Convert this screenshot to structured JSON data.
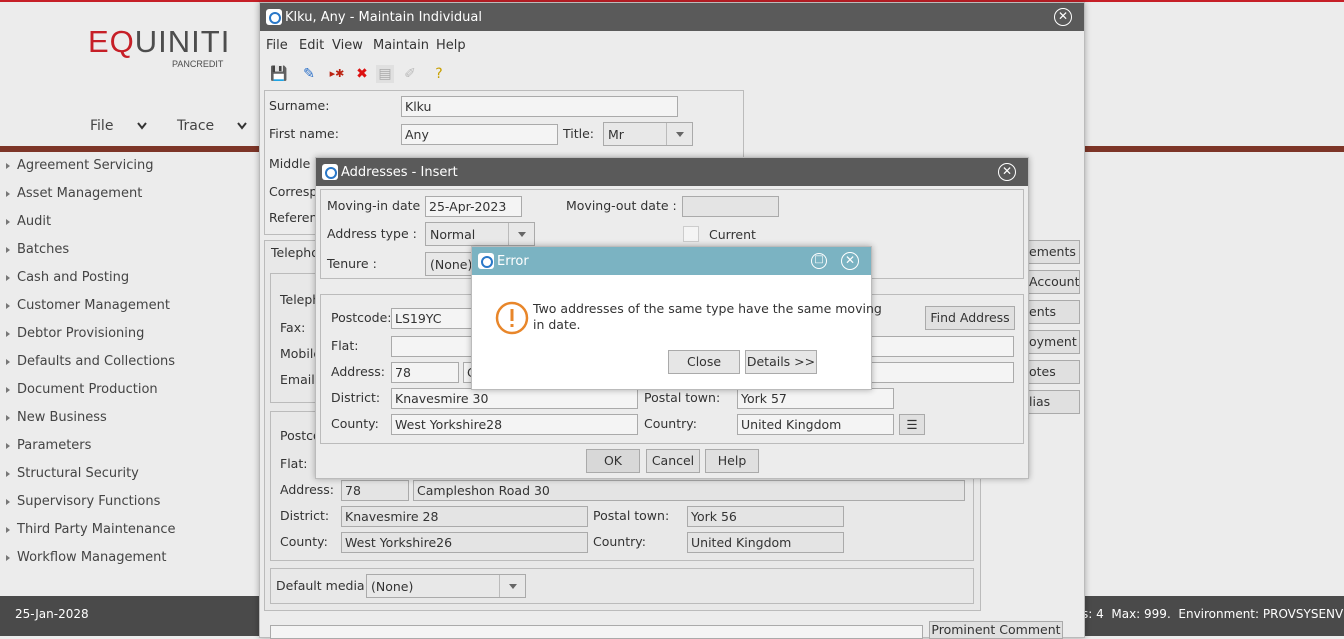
{
  "app": {
    "logo_text": "EQUINITI",
    "logo_sub": "PANCREDIT",
    "top_menu": [
      "File",
      "Trace"
    ],
    "sidebar_items": [
      "Agreement Servicing",
      "Asset Management",
      "Audit",
      "Batches",
      "Cash and Posting",
      "Customer Management",
      "Debtor Provisioning",
      "Defaults and Collections",
      "Document Production",
      "New Business",
      "Parameters",
      "Structural Security",
      "Supervisory Functions",
      "Third Party Maintenance",
      "Workflow Management"
    ],
    "footer_date": "25-Jan-2028",
    "footer_status": "s: 4  Max: 999.  Environment: PROVSYSENV"
  },
  "main_window": {
    "title": "Klku, Any - Maintain Individual",
    "menu": [
      "File",
      "Edit",
      "View",
      "Maintain",
      "Help"
    ],
    "surname_label": "Surname:",
    "surname": "Klku",
    "firstname_label": "First name:",
    "firstname": "Any",
    "title_label": "Title:",
    "title_value": "Mr",
    "middle_label": "Middle n",
    "corresp_label": "Corresp",
    "reference_label": "Referen",
    "telephone_tab": "Telepho",
    "telephone_label": "Teleph",
    "fax_label": "Fax:",
    "mobile_label": "Mobile",
    "email_label": "Email",
    "postcode_label": "Postco",
    "flat_label": "Flat:",
    "address_label": "Address:",
    "address_no": "78",
    "address_street": "Campleshon Road 30",
    "district_label": "District:",
    "district": "Knavesmire 28",
    "postal_town_label": "Postal town:",
    "postal_town": "York 56",
    "county_label": "County:",
    "county": "West Yorkshire26",
    "country_label": "Country:",
    "country": "United Kingdom",
    "default_media_label": "Default media:",
    "default_media": "(None)",
    "side_buttons": [
      "ements",
      "Account",
      "ents",
      "oyment",
      "otes",
      "lias"
    ],
    "prominent_comment": "Prominent Comment"
  },
  "address_dialog": {
    "title": "Addresses - Insert",
    "moving_in_label": "Moving-in date :",
    "moving_in": "25-Apr-2023",
    "moving_out_label": "Moving-out date :",
    "moving_out": "",
    "address_type_label": "Address type :",
    "address_type": "Normal",
    "current_label": "Current",
    "tenure_label": "Tenure :",
    "tenure": "(None)",
    "postcode_label": "Postcode:",
    "postcode": "LS19YC",
    "find_address": "Find Address",
    "flat_label": "Flat:",
    "address_label": "Address:",
    "address_no": "78",
    "address_street": "C",
    "district_label": "District:",
    "district": "Knavesmire 30",
    "postal_town_label": "Postal town:",
    "postal_town": "York 57",
    "county_label": "County:",
    "county": "West Yorkshire28",
    "country_label": "Country:",
    "country": "United Kingdom",
    "ok": "OK",
    "cancel": "Cancel",
    "help": "Help"
  },
  "error_dialog": {
    "title": "Error",
    "message_line1": "Two addresses of the same type have the same moving",
    "message_line2": "in date.",
    "close": "Close",
    "details": "Details >>"
  },
  "colors": {
    "brand_red": "#c61f27",
    "title_dark": "#5a5a5a",
    "error_title": "#7bb3c2",
    "warning_orange": "#e8862a"
  }
}
